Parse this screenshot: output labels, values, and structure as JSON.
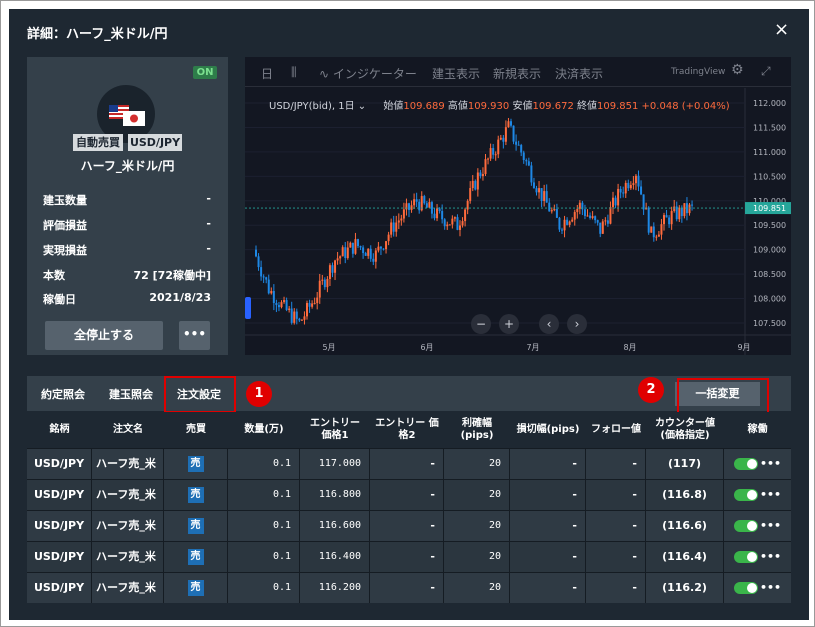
{
  "dialog": {
    "title": "詳細：ハーフ_米ドル/円",
    "close_icon": "×"
  },
  "card": {
    "on_badge": "ON",
    "tag_auto": "自動売買",
    "tag_pair": "USD/JPY",
    "name": "ハーフ_米ドル/円",
    "rows": [
      {
        "label": "建玉数量",
        "value": "-"
      },
      {
        "label": "評価損益",
        "value": "-"
      },
      {
        "label": "実現損益",
        "value": "-"
      },
      {
        "label": "本数",
        "value": "72 [72稼働中]"
      },
      {
        "label": "稼働日",
        "value": "2021/8/23"
      }
    ],
    "stop_button": "全停止する",
    "more_button": "•••"
  },
  "chart": {
    "toolbar": {
      "interval": "日",
      "indicator": "インジケーター",
      "position_view": "建玉表示",
      "new_view": "新規表示",
      "settle_view": "決済表示",
      "brand": "TradingView"
    },
    "symbol": "USD/JPY(bid), 1日",
    "open_label": "始値",
    "open": "109.689",
    "high_label": "高値",
    "high": "109.930",
    "low_label": "安値",
    "low": "109.672",
    "close_label": "終値",
    "close": "109.851",
    "change": "+0.048 (+0.04%)",
    "current_price": "109.851",
    "y_ticks": [
      "112.000",
      "111.500",
      "111.000",
      "110.500",
      "110.000",
      "109.500",
      "109.000",
      "108.500",
      "108.000",
      "107.500"
    ],
    "x_ticks": [
      "5月",
      "6月",
      "7月",
      "8月",
      "9月"
    ],
    "up_color": "#ff6b3d",
    "down_color": "#1e88e5",
    "nav": [
      "−",
      "+",
      "‹",
      "›"
    ]
  },
  "tabs": {
    "items": [
      "約定照会",
      "建玉照会",
      "注文設定"
    ],
    "bulk_button": "一括変更",
    "callout1": "1",
    "callout2": "2"
  },
  "table": {
    "headers": [
      "銘柄",
      "注文名",
      "売買",
      "数量(万)",
      "エントリー\n価格1",
      "エントリー 価\n格2",
      "利確幅\n(pips)",
      "損切幅(pips)",
      "フォロー値",
      "カウンター値\n(価格指定)",
      "稼働"
    ],
    "rows": [
      {
        "symbol": "USD/JPY",
        "name": "ハーフ売_米",
        "side": "売",
        "qty": "0.1",
        "entry1": "117.000",
        "entry2": "-",
        "tp": "20",
        "sl": "-",
        "follow": "-",
        "counter": "(117)"
      },
      {
        "symbol": "USD/JPY",
        "name": "ハーフ売_米",
        "side": "売",
        "qty": "0.1",
        "entry1": "116.800",
        "entry2": "-",
        "tp": "20",
        "sl": "-",
        "follow": "-",
        "counter": "(116.8)"
      },
      {
        "symbol": "USD/JPY",
        "name": "ハーフ売_米",
        "side": "売",
        "qty": "0.1",
        "entry1": "116.600",
        "entry2": "-",
        "tp": "20",
        "sl": "-",
        "follow": "-",
        "counter": "(116.6)"
      },
      {
        "symbol": "USD/JPY",
        "name": "ハーフ売_米",
        "side": "売",
        "qty": "0.1",
        "entry1": "116.400",
        "entry2": "-",
        "tp": "20",
        "sl": "-",
        "follow": "-",
        "counter": "(116.4)"
      },
      {
        "symbol": "USD/JPY",
        "name": "ハーフ売_米",
        "side": "売",
        "qty": "0.1",
        "entry1": "116.200",
        "entry2": "-",
        "tp": "20",
        "sl": "-",
        "follow": "-",
        "counter": "(116.2)"
      }
    ],
    "more": "•••"
  }
}
